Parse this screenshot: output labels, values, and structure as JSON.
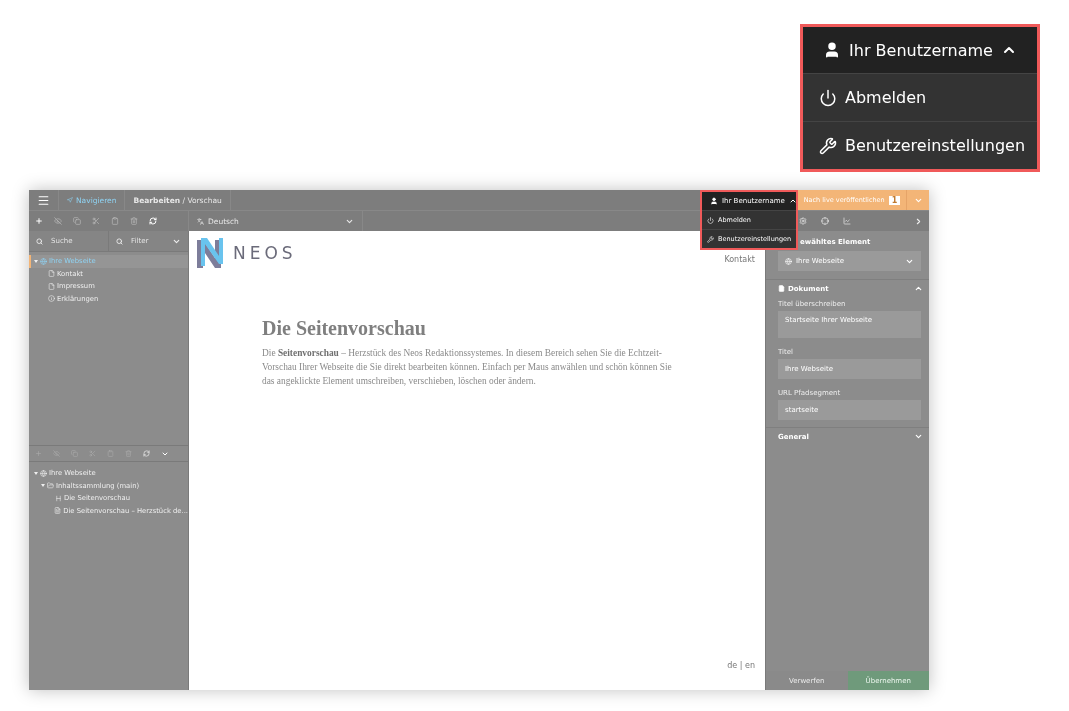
{
  "callout": {
    "user_label": "Ihr Benutzername",
    "expanded": true,
    "items": [
      {
        "label": "Abmelden",
        "kind": "logout"
      },
      {
        "label": "Benutzereinstellungen",
        "kind": "settings"
      }
    ]
  },
  "top_bar": {
    "nav_tab": {
      "label": "Navigieren",
      "selected": true
    },
    "breadcrumb": "**Bearbeiten** / Vorschau",
    "user_menu": {
      "label": "Ihr Benutzername",
      "expanded": true,
      "items": [
        {
          "label": "Abmelden",
          "kind": "logout"
        },
        {
          "label": "Benutzereinstellungen",
          "kind": "settings"
        }
      ]
    },
    "publish": {
      "label": "Nach live veröffentlichen",
      "count": "1"
    }
  },
  "dimension": {
    "label": "Deutsch"
  },
  "document_tree": {
    "search_placeholder": "Suche",
    "filter_placeholder": "Filter",
    "nodes": [
      {
        "label": "Ihre Webseite",
        "kind": "site",
        "selected": true,
        "expanded": true,
        "children": [
          {
            "label": "Kontakt",
            "kind": "page",
            "selected": false
          },
          {
            "label": "Impressum",
            "kind": "page",
            "selected": false
          },
          {
            "label": "Erklärungen",
            "kind": "info",
            "selected": false
          }
        ]
      }
    ]
  },
  "content_tree": {
    "nodes": [
      {
        "label": "Ihre Webseite",
        "kind": "site",
        "selected": false,
        "expanded": true,
        "children": [
          {
            "label": "Inhaltssammlung (main)",
            "kind": "collection",
            "selected": false,
            "expanded": true,
            "children": [
              {
                "label": "Die Seitenvorschau",
                "kind": "headline",
                "selected": false
              },
              {
                "label": "Die Seitenvorschau – Herzstück de...",
                "kind": "text",
                "selected": false
              }
            ]
          }
        ]
      }
    ]
  },
  "preview": {
    "logo_text": "NEOS",
    "menu_link": "Kontakt",
    "heading": "Die Seitenvorschau",
    "paragraph": "Die **Seitenvorschau** – Herzstück des Neos Redaktionssystemes. In diesem Bereich sehen Sie die Echtzeit-Vorschau Ihrer Webseite die Sie direkt bearbeiten können. Einfach per Maus anwählen und schön können Sie das angeklickte Element umschreiben, verschieben, löschen oder ändern.",
    "languages": "de | en"
  },
  "inspector": {
    "heading": "ewähltes Element",
    "selected_element": "Ihre Webseite",
    "sections": [
      {
        "title": "Dokument",
        "expanded": true,
        "fields": [
          {
            "label": "Titel überschreiben",
            "value": "Startseite Ihrer Webseite",
            "kind": "textarea"
          },
          {
            "label": "Titel",
            "value": "Ihre Webseite",
            "kind": "text"
          },
          {
            "label": "URL Pfadsegment",
            "value": "startseite",
            "kind": "text"
          }
        ]
      },
      {
        "title": "General",
        "expanded": false
      }
    ],
    "buttons": [
      {
        "label": "Verwerfen",
        "kind": "discard"
      },
      {
        "label": "Übernehmen",
        "kind": "apply"
      }
    ]
  }
}
